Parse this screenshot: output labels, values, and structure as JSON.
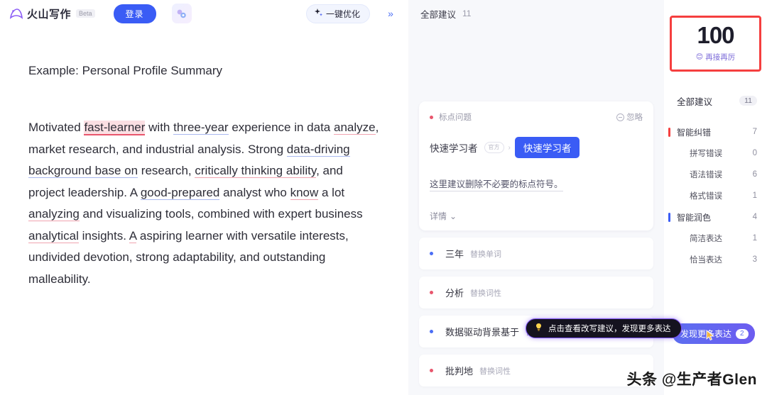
{
  "header": {
    "brand_name": "火山写作",
    "beta_tag": "Beta",
    "login_label": "登录",
    "wand_icon": "ai-wand-icon",
    "optimize_label": "一键优化",
    "optimize_icon": "sparkle-icon",
    "collapse_icon": "»"
  },
  "document": {
    "title": "Example: Personal Profile Summary",
    "paragraph_segments": [
      {
        "text": "Motivated ",
        "style": "plain"
      },
      {
        "text": "fast-learner",
        "style": "error-red"
      },
      {
        "text": " with ",
        "style": "plain"
      },
      {
        "text": "three-year",
        "style": "underline-blue"
      },
      {
        "text": " experience in data ",
        "style": "plain"
      },
      {
        "text": "analyze",
        "style": "underline-red"
      },
      {
        "text": ", market research, and industrial analysis. Strong ",
        "style": "plain"
      },
      {
        "text": "data-driving background base on",
        "style": "underline-blue"
      },
      {
        "text": " research, ",
        "style": "plain"
      },
      {
        "text": "critically thinking ability",
        "style": "underline-red"
      },
      {
        "text": ", and project leadership. A ",
        "style": "plain"
      },
      {
        "text": "good-prepared",
        "style": "underline-blue"
      },
      {
        "text": " analyst who ",
        "style": "plain"
      },
      {
        "text": "know",
        "style": "underline-red"
      },
      {
        "text": " a lot ",
        "style": "plain"
      },
      {
        "text": "analyzing",
        "style": "underline-red"
      },
      {
        "text": " and visualizing tools, combined with expert business ",
        "style": "plain"
      },
      {
        "text": "analytical",
        "style": "underline-red"
      },
      {
        "text": " insights. ",
        "style": "plain"
      },
      {
        "text": "A",
        "style": "underline-red"
      },
      {
        "text": " aspiring learner with versatile interests, undivided devotion, strong adaptability, and outstanding malleability.",
        "style": "plain"
      }
    ]
  },
  "suggestions_panel": {
    "header_label": "全部建议",
    "header_count": "11",
    "card": {
      "dot_color": "red",
      "type_label": "标点问题",
      "ignore_label": "忽略",
      "original_text": "快速学习者",
      "mini_pill_text": "官方",
      "arrow": "›",
      "replacement_text": "快速学习者",
      "explanation": "这里建议删除不必要的标点符号。",
      "detail_label": "详情",
      "detail_chevron": "⌄"
    },
    "items": [
      {
        "dot_color": "blue",
        "word": "三年",
        "action": "替换单词"
      },
      {
        "dot_color": "red",
        "word": "分析",
        "action": "替换词性"
      },
      {
        "dot_color": "blue",
        "word": "数据驱动背景基于",
        "action": "替换"
      },
      {
        "dot_color": "red",
        "word": "批判地",
        "action": "替换词性"
      }
    ]
  },
  "tooltip": {
    "icon": "lightbulb-icon",
    "text": "点击查看改写建议，发现更多表达"
  },
  "sidebar": {
    "score": {
      "value": "100",
      "emoji": "😊",
      "caption": "再接再厉"
    },
    "all_row": {
      "label": "全部建议",
      "count": "11"
    },
    "rows": [
      {
        "label": "智能纠错",
        "count": "7",
        "bar": "#f53f3f",
        "indent": false
      },
      {
        "label": "拼写错误",
        "count": "0",
        "bar": "",
        "indent": true
      },
      {
        "label": "语法错误",
        "count": "6",
        "bar": "",
        "indent": true
      },
      {
        "label": "格式错误",
        "count": "1",
        "bar": "",
        "indent": true
      },
      {
        "label": "智能润色",
        "count": "4",
        "bar": "#3a5cf5",
        "indent": false
      },
      {
        "label": "简洁表达",
        "count": "1",
        "bar": "",
        "indent": true
      },
      {
        "label": "恰当表达",
        "count": "3",
        "bar": "",
        "indent": true
      }
    ],
    "more_button": {
      "label": "发现更多表达",
      "badge": "2"
    }
  },
  "watermark": {
    "text": "头条 @生产者Glen"
  },
  "colors": {
    "accent_blue": "#3a5cf5",
    "error_red": "#f53f3f",
    "panel_bg": "#f7f8fb",
    "tooltip_purple": "#7a4ff0"
  }
}
